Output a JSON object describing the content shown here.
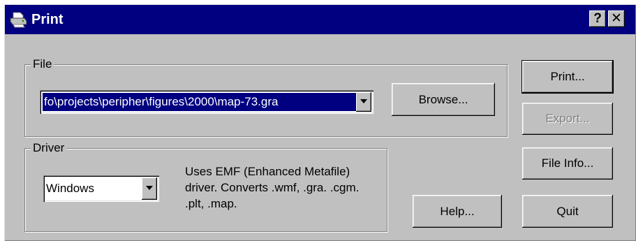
{
  "window": {
    "title": "Print",
    "help_button": "?",
    "close_button": "✕"
  },
  "file_group": {
    "label": "File",
    "path": "fo\\projects\\peripher\\figures\\2000\\map-73.gra",
    "browse_label": "Browse..."
  },
  "driver_group": {
    "label": "Driver",
    "selected": "Windows",
    "description": "Uses EMF (Enhanced Metafile) driver.  Converts .wmf, .gra. .cgm. .plt, .map."
  },
  "buttons": {
    "print": "Print...",
    "export": "Export...",
    "file_info": "File Info...",
    "help": "Help...",
    "quit": "Quit"
  }
}
